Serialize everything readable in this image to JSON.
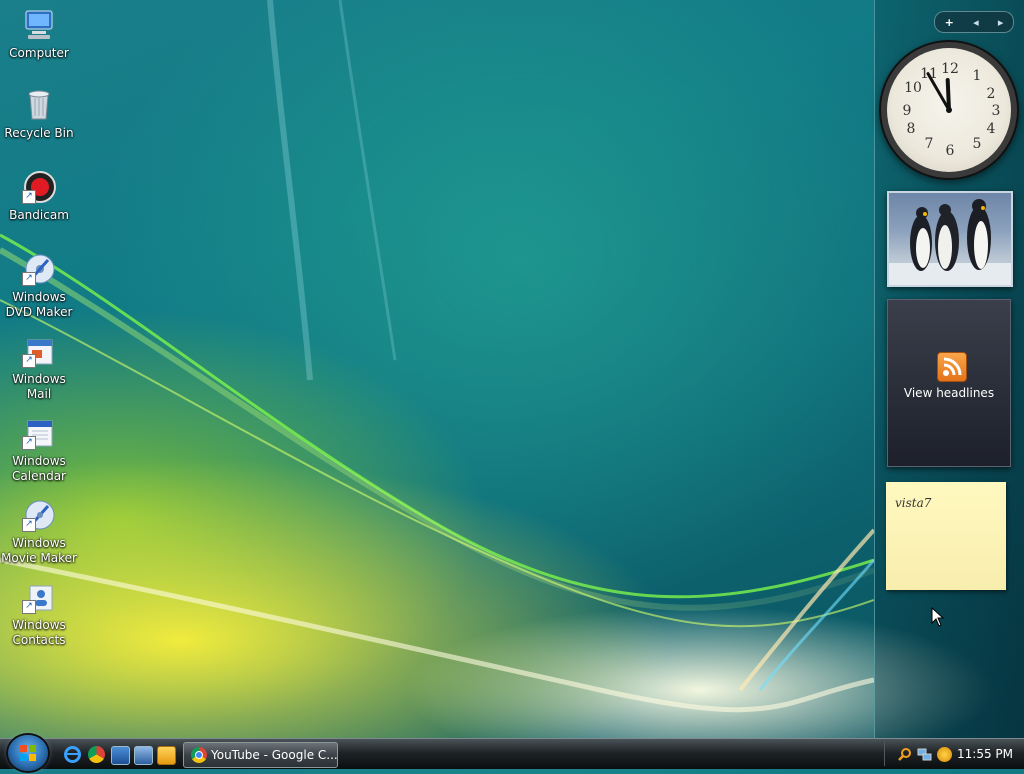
{
  "desktop": {
    "icons": [
      {
        "label": "Computer",
        "icon": "computer-icon"
      },
      {
        "label": "Recycle Bin",
        "icon": "recycle-bin-icon"
      },
      {
        "label": "Bandicam",
        "icon": "bandicam-icon"
      },
      {
        "label": "Windows DVD Maker",
        "icon": "dvd-maker-icon"
      },
      {
        "label": "Windows Mail",
        "icon": "mail-icon"
      },
      {
        "label": "Windows Calendar",
        "icon": "calendar-icon"
      },
      {
        "label": "Windows Movie Maker",
        "icon": "movie-maker-icon"
      },
      {
        "label": "Windows Contacts",
        "icon": "contacts-icon"
      }
    ]
  },
  "sidebar": {
    "controls": {
      "add": "+",
      "prev": "◂",
      "next": "▸"
    },
    "clock": {
      "numerals": [
        "12",
        "1",
        "2",
        "3",
        "4",
        "5",
        "6",
        "7",
        "8",
        "9",
        "10",
        "11"
      ],
      "time": "11:55"
    },
    "slideshow": {
      "subject": "penguins-photo"
    },
    "feeds": {
      "label": "View headlines",
      "icon": "rss-icon"
    },
    "note": {
      "text": "vista7"
    }
  },
  "taskbar": {
    "start_icon": "windows-start-orb",
    "quick_launch": [
      "internet-explorer-icon",
      "chrome-icon",
      "show-desktop-icon",
      "switch-windows-icon",
      "media-player-icon"
    ],
    "window_button": {
      "label": "YouTube - Google C...",
      "icon": "chrome-icon"
    },
    "tray_icons": [
      "search-icon",
      "network-icon",
      "shield-icon"
    ],
    "time": "11:55 PM"
  },
  "colors": {
    "accent": "#1a7f8a",
    "taskbar": "#1f2427",
    "note": "#fff9c0",
    "rss": "#f08a2e"
  }
}
